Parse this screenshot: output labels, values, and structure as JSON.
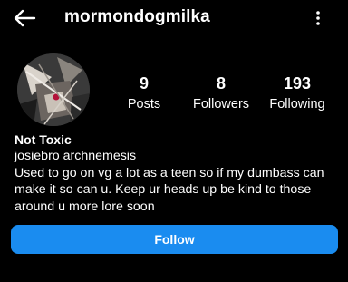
{
  "header": {
    "back_icon": "arrow-left-icon",
    "username": "mormondogmilka",
    "menu_icon": "more-vertical-icon"
  },
  "profile": {
    "avatar_icon": "profile-avatar",
    "stats": [
      {
        "value": "9",
        "label": "Posts"
      },
      {
        "value": "8",
        "label": "Followers"
      },
      {
        "value": "193",
        "label": "Following"
      }
    ],
    "display_name": "Not Toxic",
    "bio_lines": [
      "josiebro archnemesis",
      "Used to go on vg a lot as a teen so if my dumbass can",
      "make it so can u. Keep ur heads up be kind to those",
      "around u more lore soon"
    ]
  },
  "actions": {
    "follow_label": "Follow"
  },
  "colors": {
    "background": "#000000",
    "text": "#ffffff",
    "follow_button": "#1a8cf0"
  }
}
